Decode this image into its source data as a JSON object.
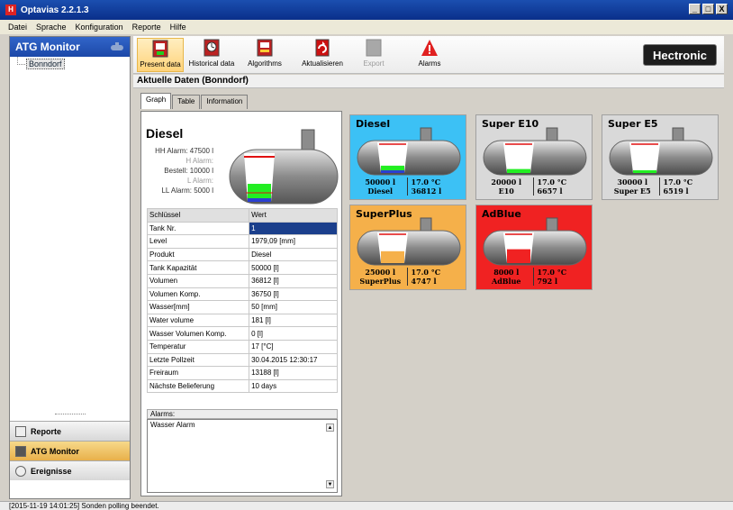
{
  "window": {
    "title": "Optavias 2.2.1.3",
    "icon": "app-logo-icon",
    "controls": [
      "_",
      "□",
      "X"
    ]
  },
  "menu": [
    "Datei",
    "Sprache",
    "Konfiguration",
    "Reporte",
    "Hilfe"
  ],
  "sidebar": {
    "title": "ATG Monitor",
    "tree": [
      "Bonndorf"
    ],
    "nav": [
      {
        "label": "Reporte",
        "icon": "report-icon"
      },
      {
        "label": "ATG Monitor",
        "icon": "tank-icon"
      },
      {
        "label": "Ereignisse",
        "icon": "clock-icon"
      }
    ]
  },
  "toolbar": {
    "buttons": [
      {
        "label": "Present data",
        "icon": "present-data-icon"
      },
      {
        "label": "Historical data",
        "icon": "historical-data-icon"
      },
      {
        "label": "Algorithms",
        "icon": "algorithms-icon"
      },
      {
        "label": "Aktualisieren",
        "icon": "refresh-icon"
      },
      {
        "label": "Export",
        "icon": "export-icon"
      },
      {
        "label": "Alarms",
        "icon": "alarm-warning-icon"
      }
    ],
    "logo": "Hectronic"
  },
  "page_title": "Aktuelle Daten (Bonndorf)",
  "tabs": [
    "Graph",
    "Table",
    "Information"
  ],
  "detail": {
    "product": "Diesel",
    "alarm_lines": [
      {
        "label": "HH Alarm:",
        "value": "47500 l"
      },
      {
        "label": "H Alarm:",
        "value": ""
      },
      {
        "label": "Bestell:",
        "value": "10000 l"
      },
      {
        "label": "L Alarm:",
        "value": ""
      },
      {
        "label": "LL Alarm:",
        "value": "5000 l"
      }
    ],
    "fill_level": 0.37,
    "colors": {
      "fill": "#22ee22",
      "water": "#2b3fd1",
      "hh_line": "#e01010"
    },
    "table": {
      "headers": [
        "Schlüssel",
        "Wert"
      ],
      "rows": [
        [
          "Tank Nr.",
          "1"
        ],
        [
          "Level",
          "1979,09 [mm]"
        ],
        [
          "Produkt",
          "Diesel"
        ],
        [
          "Tank Kapazität",
          "50000 [l]"
        ],
        [
          "Volumen",
          "36812 [l]"
        ],
        [
          "Volumen Komp.",
          "36750 [l]"
        ],
        [
          "Wasser[mm]",
          "50 [mm]"
        ],
        [
          "Water volume",
          "181 [l]"
        ],
        [
          "Wasser Volumen Komp.",
          "0 [l]"
        ],
        [
          "Temperatur",
          "17 [°C]"
        ],
        [
          "Letzte Pollzeit",
          "30.04.2015 12:30:17"
        ],
        [
          "Freiraum",
          "13188 [l]"
        ],
        [
          "Nächste Belieferung",
          "10 days"
        ]
      ]
    },
    "alarms_label": "Alarms:",
    "alarms_text": "Wasser Alarm"
  },
  "tanks": [
    {
      "name": "Diesel",
      "volume": "50000 l",
      "product": "Diesel",
      "temp": "17.0 °C",
      "level": "36812 l",
      "fill": 0.37,
      "bg": "#3cc1f5",
      "fill_color": "#22ee22",
      "water": true
    },
    {
      "name": "Super E10",
      "volume": "20000 l",
      "product": "E10",
      "temp": "17.0 °C",
      "level": "6657 l",
      "fill": 0.2,
      "bg": "#d9d9d9",
      "fill_color": "#22ee22",
      "water": false
    },
    {
      "name": "Super E5",
      "volume": "30000 l",
      "product": "Super E5",
      "temp": "17.0 °C",
      "level": "6519 l",
      "fill": 0.14,
      "bg": "#d9d9d9",
      "fill_color": "#22ee22",
      "water": false
    },
    {
      "name": "SuperPlus",
      "volume": "25000 l",
      "product": "SuperPlus",
      "temp": "17.0 °C",
      "level": "4747 l",
      "fill": 0.6,
      "bg": "#f5b04a",
      "fill_color": "#f5b04a",
      "water": false
    },
    {
      "name": "AdBlue",
      "volume": "8000 l",
      "product": "AdBlue",
      "temp": "17.0 °C",
      "level": "792 l",
      "fill": 0.7,
      "bg": "#f02222",
      "fill_color": "#f02222",
      "water": false
    }
  ],
  "status": "[2015-11-19 14:01:25] Sonden polling beendet."
}
